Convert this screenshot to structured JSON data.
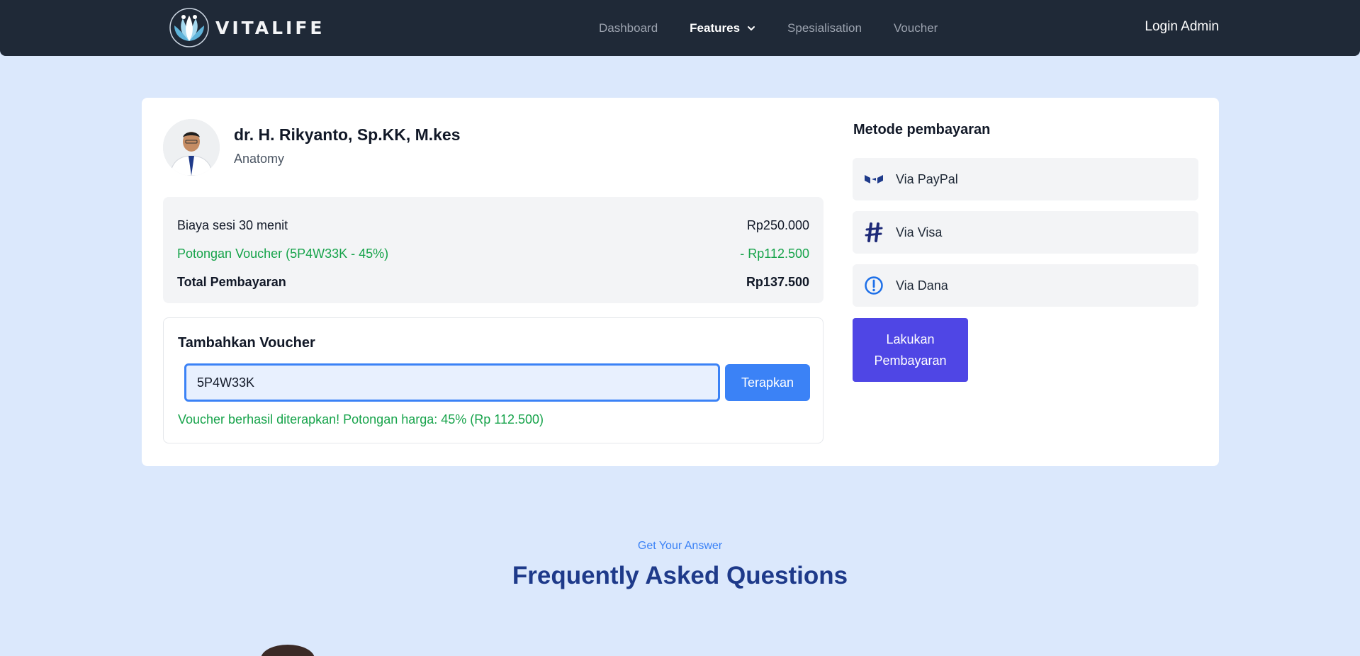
{
  "brand": {
    "name": "VITALIFE"
  },
  "nav": {
    "links": [
      {
        "label": "Dashboard"
      },
      {
        "label": "Features"
      },
      {
        "label": "Spesialisation"
      },
      {
        "label": "Voucher"
      }
    ],
    "login_label": "Login Admin"
  },
  "doctor": {
    "name": "dr. H. Rikyanto, Sp.KK, M.kes",
    "specialty": "Anatomy"
  },
  "summary": {
    "session": {
      "label": "Biaya sesi 30 menit",
      "value": "Rp250.000"
    },
    "discount": {
      "label": "Potongan Voucher (5P4W33K - 45%)",
      "value": "- Rp112.500"
    },
    "total": {
      "label": "Total Pembayaran",
      "value": "Rp137.500"
    }
  },
  "voucher": {
    "title": "Tambahkan Voucher",
    "input_value": "5P4W33K",
    "apply_label": "Terapkan",
    "message": "Voucher berhasil diterapkan! Potongan harga: 45% (Rp 112.500)"
  },
  "payment": {
    "title": "Metode pembayaran",
    "options": [
      {
        "label": "Via PayPal",
        "icon": "paypal-icon"
      },
      {
        "label": "Via Visa",
        "icon": "visa-icon"
      },
      {
        "label": "Via Dana",
        "icon": "dana-icon"
      }
    ],
    "pay_label_line1": "Lakukan",
    "pay_label_line2": "Pembayaran"
  },
  "faq": {
    "kicker": "Get Your Answer",
    "title": "Frequently Asked Questions"
  },
  "colors": {
    "navbar": "#1f2937",
    "page_bg": "#dbe8fc",
    "accent_blue": "#3b82f6",
    "pay_button": "#4f46e5",
    "success_green": "#16a34a",
    "faq_title": "#1e3a8a"
  }
}
